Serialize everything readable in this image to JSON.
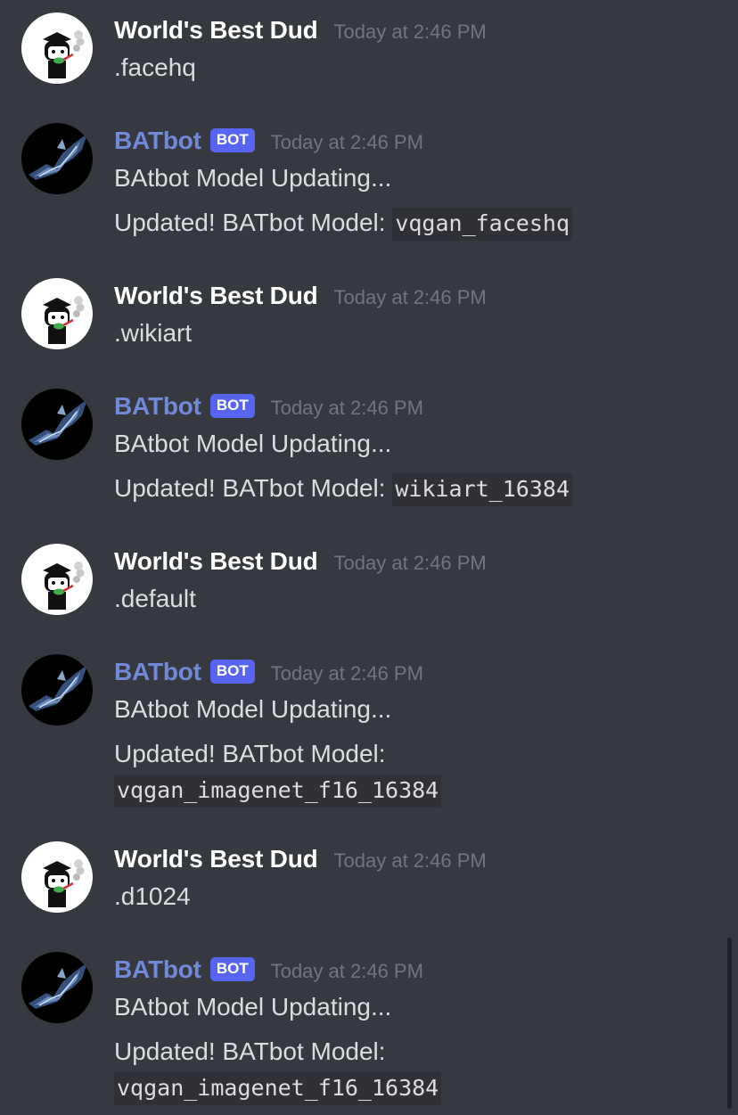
{
  "messages": [
    {
      "author": "World's Best Dud",
      "timestamp": "Today at 2:46 PM",
      "text": ".facehq"
    },
    {
      "author": "BATbot",
      "bot_tag": "BOT",
      "timestamp": "Today at 2:46 PM",
      "line1": "BAtbot Model Updating...",
      "line2_prefix": "Updated! BATbot Model:",
      "model": "vqgan_faceshq"
    },
    {
      "author": "World's Best Dud",
      "timestamp": "Today at 2:46 PM",
      "text": ".wikiart"
    },
    {
      "author": "BATbot",
      "bot_tag": "BOT",
      "timestamp": "Today at 2:46 PM",
      "line1": "BAtbot Model Updating...",
      "line2_prefix": "Updated! BATbot Model:",
      "model": "wikiart_16384"
    },
    {
      "author": "World's Best Dud",
      "timestamp": "Today at 2:46 PM",
      "text": ".default"
    },
    {
      "author": "BATbot",
      "bot_tag": "BOT",
      "timestamp": "Today at 2:46 PM",
      "line1": "BAtbot Model Updating...",
      "line2_prefix": "Updated! BATbot Model:",
      "model": "vqgan_imagenet_f16_16384"
    },
    {
      "author": "World's Best Dud",
      "timestamp": "Today at 2:46 PM",
      "text": ".d1024"
    },
    {
      "author": "BATbot",
      "bot_tag": "BOT",
      "timestamp": "Today at 2:46 PM",
      "line1": "BAtbot Model Updating...",
      "line2_prefix": "Updated! BATbot Model:",
      "model": "vqgan_imagenet_f16_16384"
    }
  ],
  "colors": {
    "background": "#36393f",
    "bot_name": "#7289da",
    "bot_tag": "#5865f2",
    "timestamp": "#72767d",
    "text": "#dcddde",
    "code_bg": "#2f3136"
  },
  "icons": {
    "user_avatar": "smoking-character-avatar",
    "bot_avatar": "bat-avatar"
  }
}
